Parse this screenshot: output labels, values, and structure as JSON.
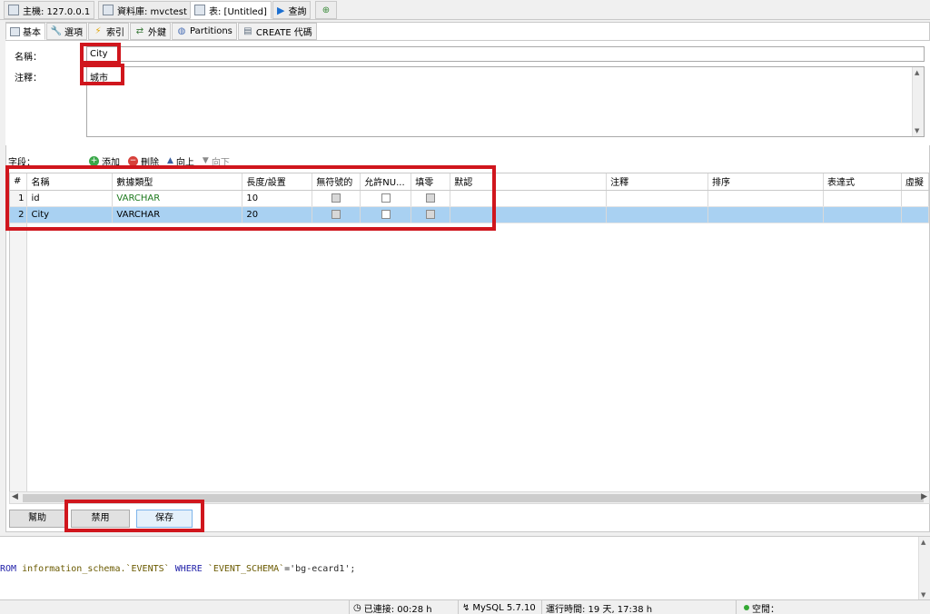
{
  "top_tabs": [
    {
      "label": "主機: 127.0.0.1",
      "icon": "server-icon"
    },
    {
      "label": "資料庫: mvctest",
      "icon": "database-icon"
    },
    {
      "label": "表: [Untitled]",
      "icon": "table-icon"
    },
    {
      "label": "查詢",
      "icon": "play-icon"
    }
  ],
  "sub_tabs": [
    {
      "label": "基本",
      "icon": "table-icon"
    },
    {
      "label": "選項",
      "icon": "wrench-icon"
    },
    {
      "label": "索引",
      "icon": "lightning-icon"
    },
    {
      "label": "外鍵",
      "icon": "foreign-key-icon"
    },
    {
      "label": "Partitions",
      "icon": "partitions-icon"
    },
    {
      "label": "CREATE 代碼",
      "icon": "code-icon"
    }
  ],
  "form": {
    "name_label": "名稱：",
    "name_value": "City",
    "comment_label": "注釋：",
    "comment_value": "城市"
  },
  "fields_toolbar": {
    "label": "字段：",
    "add": "添加",
    "remove": "刪除",
    "up": "向上",
    "down": "向下"
  },
  "columns_table": {
    "headers": [
      "#",
      "名稱",
      "數據類型",
      "長度/設置",
      "無符號的",
      "允許NU...",
      "填零",
      "默認",
      "注釋",
      "排序",
      "表達式",
      "虛擬"
    ],
    "rows": [
      {
        "num": "1",
        "name": "id",
        "type": "VARCHAR",
        "length": "10",
        "unsigned": false,
        "allow_null": false,
        "zerofill": false,
        "selected": false
      },
      {
        "num": "2",
        "name": "City",
        "type": "VARCHAR",
        "length": "20",
        "unsigned": false,
        "allow_null": false,
        "zerofill": false,
        "selected": true
      }
    ]
  },
  "buttons": {
    "help": "幫助",
    "discard": "禁用",
    "save": "保存"
  },
  "sql_log": {
    "line_start": "ROM",
    "schema_part": "information_schema.`EVENTS`",
    "where": "WHERE",
    "column": "`EVENT_SCHEMA`",
    "value": "='bg-ecard1';"
  },
  "status": {
    "connected": "已連接: 00:28 h",
    "server": "MySQL 5.7.10",
    "uptime": "運行時間: 19 天, 17:38 h",
    "idle": "空閒："
  },
  "colors": {
    "highlight": "#d0161d",
    "selected_row": "#a9d1f2",
    "datatype": "#1e7a1e"
  }
}
